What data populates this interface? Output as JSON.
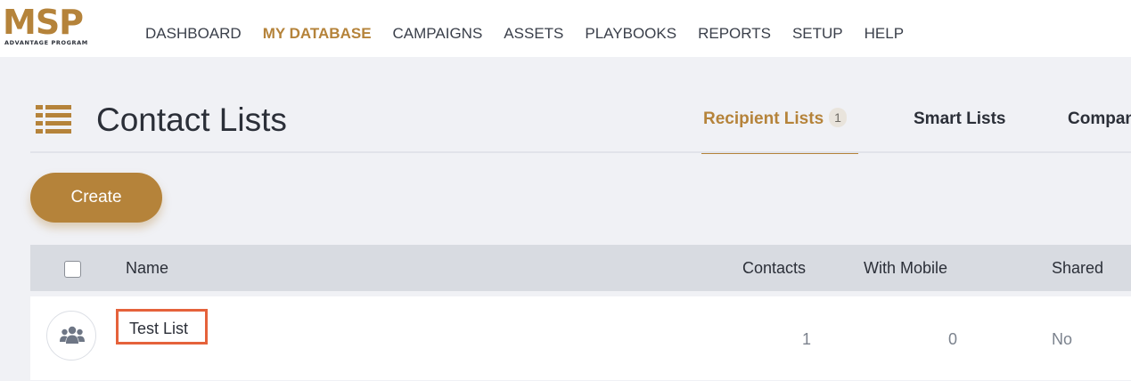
{
  "brand": {
    "name": "MSP",
    "tagline": "ADVANTAGE PROGRAM",
    "accent": "#b5833a"
  },
  "nav": {
    "items": [
      "DASHBOARD",
      "MY DATABASE",
      "CAMPAIGNS",
      "ASSETS",
      "PLAYBOOKS",
      "REPORTS",
      "SETUP",
      "HELP"
    ],
    "active": "MY DATABASE"
  },
  "page": {
    "title": "Contact Lists",
    "icon": "list-icon"
  },
  "tabs": [
    {
      "label": "Recipient Lists",
      "badge": "1",
      "active": true
    },
    {
      "label": "Smart Lists"
    },
    {
      "label": "Compan"
    }
  ],
  "actions": {
    "create_label": "Create"
  },
  "table": {
    "headers": {
      "name": "Name",
      "contacts": "Contacts",
      "with_mobile": "With Mobile",
      "shared": "Shared"
    },
    "rows": [
      {
        "icon": "group-icon",
        "name": "Test List",
        "contacts": "1",
        "with_mobile": "0",
        "shared": "No"
      }
    ]
  }
}
